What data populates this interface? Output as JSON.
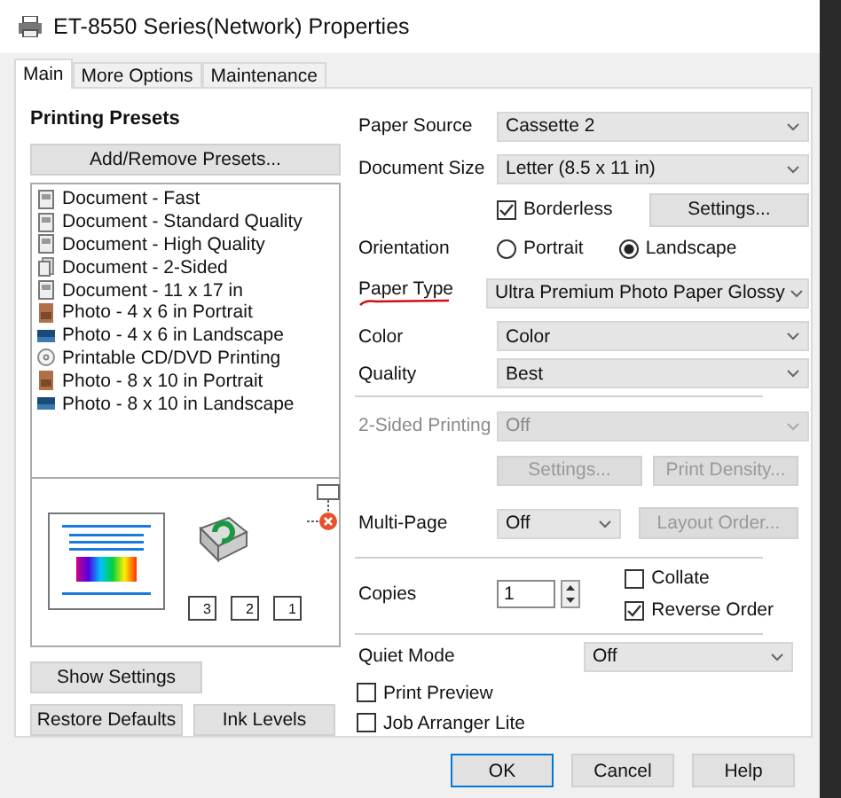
{
  "window": {
    "title": "ET-8550 Series(Network) Properties"
  },
  "tabs": [
    {
      "label": "Main",
      "selected": true
    },
    {
      "label": "More Options",
      "selected": false
    },
    {
      "label": "Maintenance",
      "selected": false
    }
  ],
  "presets": {
    "title": "Printing Presets",
    "add_button": "Add/Remove Presets...",
    "items": [
      {
        "label": "Document - Fast",
        "kind": "document"
      },
      {
        "label": "Document - Standard Quality",
        "kind": "document"
      },
      {
        "label": "Document - High Quality",
        "kind": "document"
      },
      {
        "label": "Document - 2-Sided",
        "kind": "two-sided"
      },
      {
        "label": "Document - 11 x 17 in",
        "kind": "document"
      },
      {
        "label": "Photo - 4 x 6 in Portrait",
        "kind": "portrait"
      },
      {
        "label": "Photo - 4 x 6 in Landscape",
        "kind": "landscape"
      },
      {
        "label": "Printable CD/DVD Printing",
        "kind": "disc"
      },
      {
        "label": "Photo - 8 x 10 in Portrait",
        "kind": "portrait"
      },
      {
        "label": "Photo - 8 x 10 in Landscape",
        "kind": "landscape"
      }
    ]
  },
  "preview": {
    "page_order": [
      "3",
      "2",
      "1"
    ]
  },
  "left_buttons": {
    "show_settings": "Show Settings",
    "restore_defaults": "Restore Defaults",
    "ink_levels": "Ink Levels"
  },
  "paper_source": {
    "label": "Paper Source",
    "value": "Cassette 2"
  },
  "document_size": {
    "label": "Document Size",
    "value": "Letter (8.5 x 11 in)"
  },
  "borderless": {
    "label": "Borderless",
    "checked": true
  },
  "borderless_settings": {
    "label": "Settings...",
    "disabled": false
  },
  "orientation": {
    "label": "Orientation",
    "options": [
      {
        "label": "Portrait",
        "selected": false
      },
      {
        "label": "Landscape",
        "selected": true
      }
    ]
  },
  "paper_type": {
    "label": "Paper Type",
    "value": "Ultra Premium Photo Paper Glossy",
    "marked": true
  },
  "color": {
    "label": "Color",
    "value": "Color"
  },
  "quality": {
    "label": "Quality",
    "value": "Best"
  },
  "two_sided": {
    "label": "2-Sided Printing",
    "value": "Off",
    "disabled": true
  },
  "two_sided_buttons": [
    {
      "label": "Settings...",
      "disabled": true
    },
    {
      "label": "Print Density...",
      "disabled": true
    }
  ],
  "multi_page": {
    "label": "Multi-Page",
    "value": "Off"
  },
  "layout_order": {
    "label": "Layout Order...",
    "disabled": true
  },
  "copies": {
    "label": "Copies",
    "value": "1"
  },
  "collate": {
    "label": "Collate",
    "checked": false
  },
  "reverse_order": {
    "label": "Reverse Order",
    "checked": true
  },
  "quiet_mode": {
    "label": "Quiet Mode",
    "value": "Off"
  },
  "print_preview": {
    "label": "Print Preview",
    "checked": false
  },
  "job_arranger": {
    "label": "Job Arranger Lite",
    "checked": false
  },
  "dialog_buttons": [
    {
      "label": "OK",
      "default": true
    },
    {
      "label": "Cancel",
      "default": false
    },
    {
      "label": "Help",
      "default": false
    }
  ]
}
